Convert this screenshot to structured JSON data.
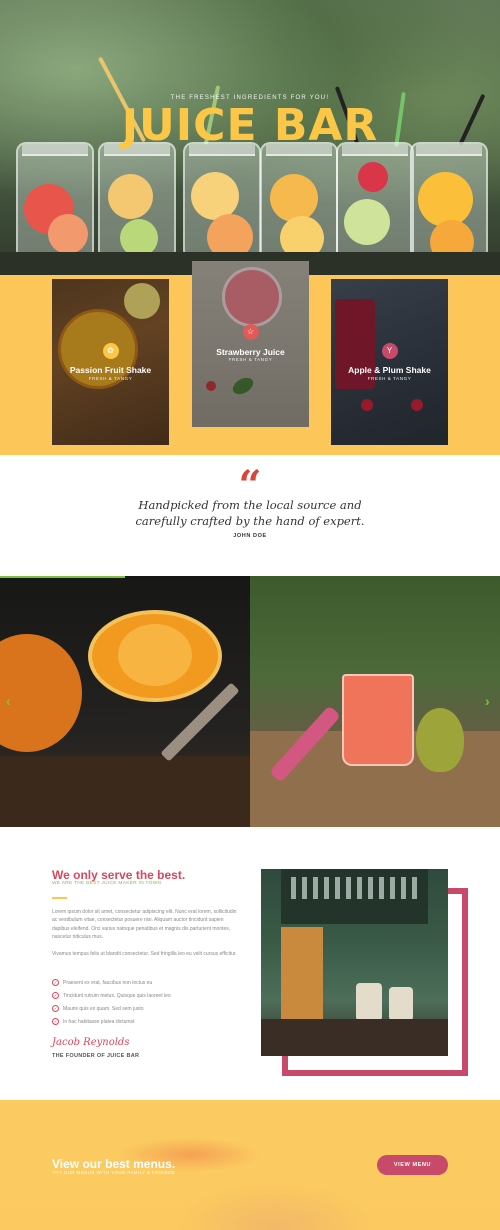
{
  "hero": {
    "kicker": "THE FRESHEST INGREDIENTS FOR YOU!",
    "title": "JUICE BAR"
  },
  "products": [
    {
      "name": "Passion Fruit Shake",
      "subtitle": "FRESH & TANGY",
      "badge_color": "#fcc747",
      "badge_icon": "leaf-icon"
    },
    {
      "name": "Strawberry Juice",
      "subtitle": "FRESH & TANGY",
      "badge_color": "#e05a58",
      "badge_icon": "star-icon"
    },
    {
      "name": "Apple & Plum Shake",
      "subtitle": "FRESH & TANGY",
      "badge_color": "#c74a6a",
      "badge_icon": "cup-icon"
    }
  ],
  "testimonial": {
    "quote_icon": "quote-icon",
    "text": "Handpicked from the local source and carefully crafted by the hand of expert.",
    "author": "JOHN DOE"
  },
  "slider": {
    "prev_icon": "chevron-left-icon",
    "next_icon": "chevron-right-icon",
    "progress": 0.25
  },
  "about": {
    "title": "We only serve the best.",
    "subtitle": "WE ARE THE BEST JUICE MAKER IN TOWN",
    "paragraph1": "Lorem ipsum dolor sit amet, consectetur adipiscing elit. Nunc erat lorem, sollicitudin ac vestibulum vitae, consectetur posuere nisi. Aliquam auctor tincidunt sapien dapibus eleifend. Orci varius natoque penatibus et magnis dis parturient montes, nascetur ridiculus mus.",
    "paragraph2": "Vivamus tempus felis ut blandit consectetur. Sed fringilla leo eu velit cursus efficitur.",
    "checklist": [
      "Praesent ex erat, faucibus non lectus eu",
      "Tincidunt rutrum metus. Quisque quis laoreet leo",
      "Mauris quis ex quam. Sed sem justo",
      "In hac habitasse platea dictumst"
    ],
    "signature": "Jacob Reynolds",
    "founder": "THE FOUNDER OF JUICE BAR"
  },
  "cta": {
    "title": "View our best menus.",
    "subtitle": "TRY OUR MENUS WITH YOUR FAMILY & FRIENDS",
    "button": "VIEW MENU"
  },
  "colors": {
    "accent_yellow": "#fcc747",
    "accent_pink": "#c74a6a",
    "accent_red": "#d9465d",
    "accent_green": "#7cc242"
  }
}
